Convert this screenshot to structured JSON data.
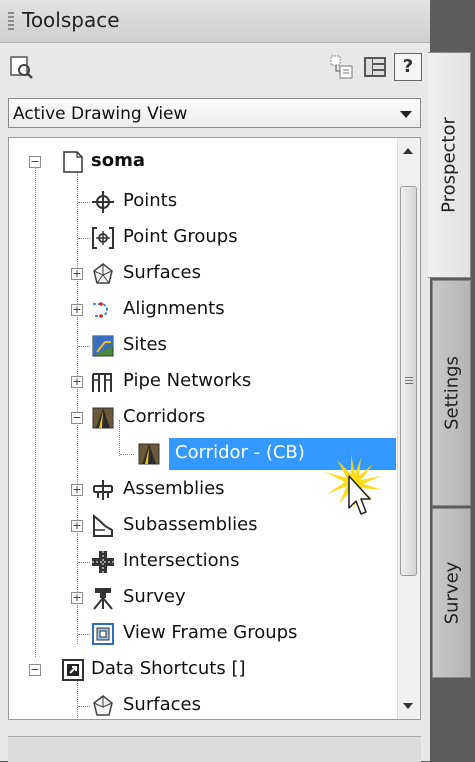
{
  "window": {
    "title": "Toolspace"
  },
  "toolbar": {
    "help_label": "?"
  },
  "view_selector": {
    "value": "Active Drawing View"
  },
  "tree": {
    "items": [
      {
        "label": "soma",
        "bold": true
      },
      {
        "label": "Points"
      },
      {
        "label": "Point Groups"
      },
      {
        "label": "Surfaces"
      },
      {
        "label": "Alignments"
      },
      {
        "label": "Sites"
      },
      {
        "label": "Pipe Networks"
      },
      {
        "label": "Corridors"
      },
      {
        "label": "Corridor - (CB)",
        "selected": true
      },
      {
        "label": "Assemblies"
      },
      {
        "label": "Subassemblies"
      },
      {
        "label": "Intersections"
      },
      {
        "label": "Survey"
      },
      {
        "label": "View Frame Groups"
      },
      {
        "label": "Data Shortcuts []"
      },
      {
        "label": "Surfaces"
      }
    ]
  },
  "side_tabs": [
    {
      "label": "Prospector",
      "active": true
    },
    {
      "label": "Settings",
      "active": false
    },
    {
      "label": "Survey",
      "active": false
    }
  ],
  "colors": {
    "selection": "#3399ff",
    "cursor_highlight": "#ffd700"
  }
}
